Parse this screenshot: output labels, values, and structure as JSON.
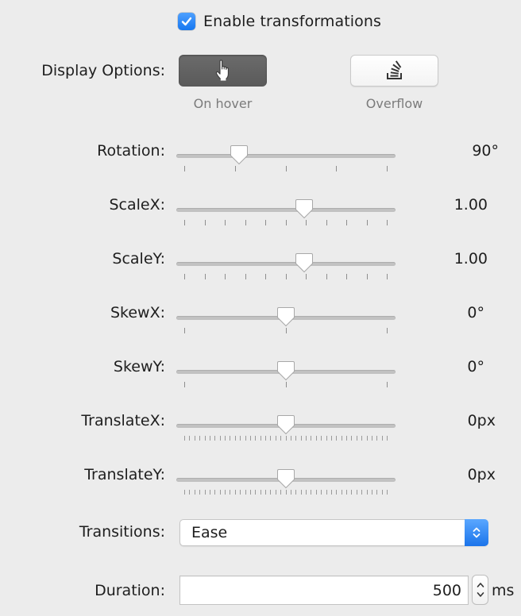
{
  "enable_transformations": {
    "label": "Enable transformations",
    "checked": true
  },
  "display_options": {
    "label": "Display Options:",
    "options": [
      {
        "caption": "On hover",
        "icon": "pointing-hand-icon",
        "selected": true
      },
      {
        "caption": "Overflow",
        "icon": "stack-overflow-icon",
        "selected": false
      }
    ]
  },
  "sliders": [
    {
      "label": "Rotation:",
      "value_text": "90°",
      "position": 0.27,
      "ticks": 5
    },
    {
      "label": "ScaleX:",
      "value_text": "1.00",
      "position": 0.59,
      "ticks": 11
    },
    {
      "label": "ScaleY:",
      "value_text": "1.00",
      "position": 0.59,
      "ticks": 11
    },
    {
      "label": "SkewX:",
      "value_text": "0°",
      "position": 0.5,
      "ticks": 3
    },
    {
      "label": "SkewY:",
      "value_text": "0°",
      "position": 0.5,
      "ticks": 3
    },
    {
      "label": "TranslateX:",
      "value_text": "0px",
      "position": 0.5,
      "ticks": 41
    },
    {
      "label": "TranslateY:",
      "value_text": "0px",
      "position": 0.5,
      "ticks": 41
    }
  ],
  "transitions": {
    "label": "Transitions:",
    "selected": "Ease"
  },
  "duration": {
    "label": "Duration:",
    "value": "500",
    "unit": "ms"
  },
  "colors": {
    "accent": "#1677f0",
    "background": "#ececec",
    "selected_button": "#616161"
  }
}
